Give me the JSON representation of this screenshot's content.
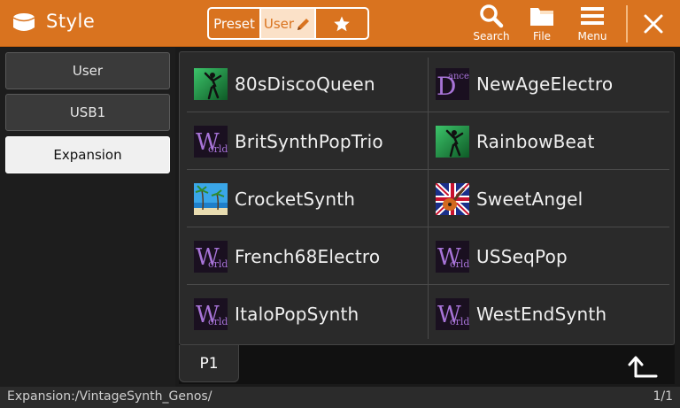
{
  "header": {
    "title": "Style",
    "tabs": {
      "preset": "Preset",
      "user": "User",
      "favorite_icon": "star-icon"
    },
    "buttons": {
      "search": "Search",
      "file": "File",
      "menu": "Menu"
    },
    "accent_color": "#d9731f"
  },
  "sidebar": {
    "items": [
      {
        "label": "User",
        "active": false
      },
      {
        "label": "USB1",
        "active": false
      },
      {
        "label": "Expansion",
        "active": true
      }
    ]
  },
  "list": {
    "rows": [
      {
        "left": {
          "name": "80sDiscoQueen",
          "icon": "dancer-icon"
        },
        "right": {
          "name": "NewAgeElectro",
          "icon": "dance-icon"
        }
      },
      {
        "left": {
          "name": "BritSynthPopTrio",
          "icon": "world-icon"
        },
        "right": {
          "name": "RainbowBeat",
          "icon": "dancer-icon"
        }
      },
      {
        "left": {
          "name": "CrocketSynth",
          "icon": "beach-icon"
        },
        "right": {
          "name": "SweetAngel",
          "icon": "union-jack-guitar-icon"
        }
      },
      {
        "left": {
          "name": "French68Electro",
          "icon": "world-icon"
        },
        "right": {
          "name": "USSeqPop",
          "icon": "world-icon"
        }
      },
      {
        "left": {
          "name": "ItaloPopSynth",
          "icon": "world-icon"
        },
        "right": {
          "name": "WestEndSynth",
          "icon": "world-icon"
        }
      }
    ]
  },
  "pager": {
    "page_label": "P1"
  },
  "status": {
    "path": "Expansion:/VintageSynth_Genos/",
    "page": "1/1"
  }
}
